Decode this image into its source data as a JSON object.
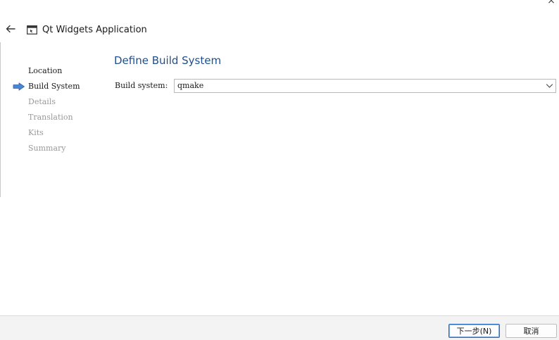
{
  "window": {
    "close_icon": "close-icon",
    "title": "Qt Widgets Application",
    "back_icon": "arrow-left-icon",
    "app_icon": "qt-application-icon"
  },
  "wizard": {
    "steps": [
      {
        "label": "Location",
        "state": "done"
      },
      {
        "label": "Build System",
        "state": "current"
      },
      {
        "label": "Details",
        "state": "pending"
      },
      {
        "label": "Translation",
        "state": "pending"
      },
      {
        "label": "Kits",
        "state": "pending"
      },
      {
        "label": "Summary",
        "state": "pending"
      }
    ],
    "current_step_icon": "arrow-right-icon"
  },
  "page": {
    "title": "Define Build System",
    "build_system": {
      "label": "Build system:",
      "value": "qmake",
      "chevron_icon": "chevron-down-icon"
    }
  },
  "footer": {
    "next_label": "下一步(N)",
    "cancel_label": "取消"
  },
  "colors": {
    "title_blue": "#1d4f91",
    "step_arrow": "#4a86d4",
    "pending_step": "#9a9a9a",
    "primary_border": "#2f6fbf"
  }
}
